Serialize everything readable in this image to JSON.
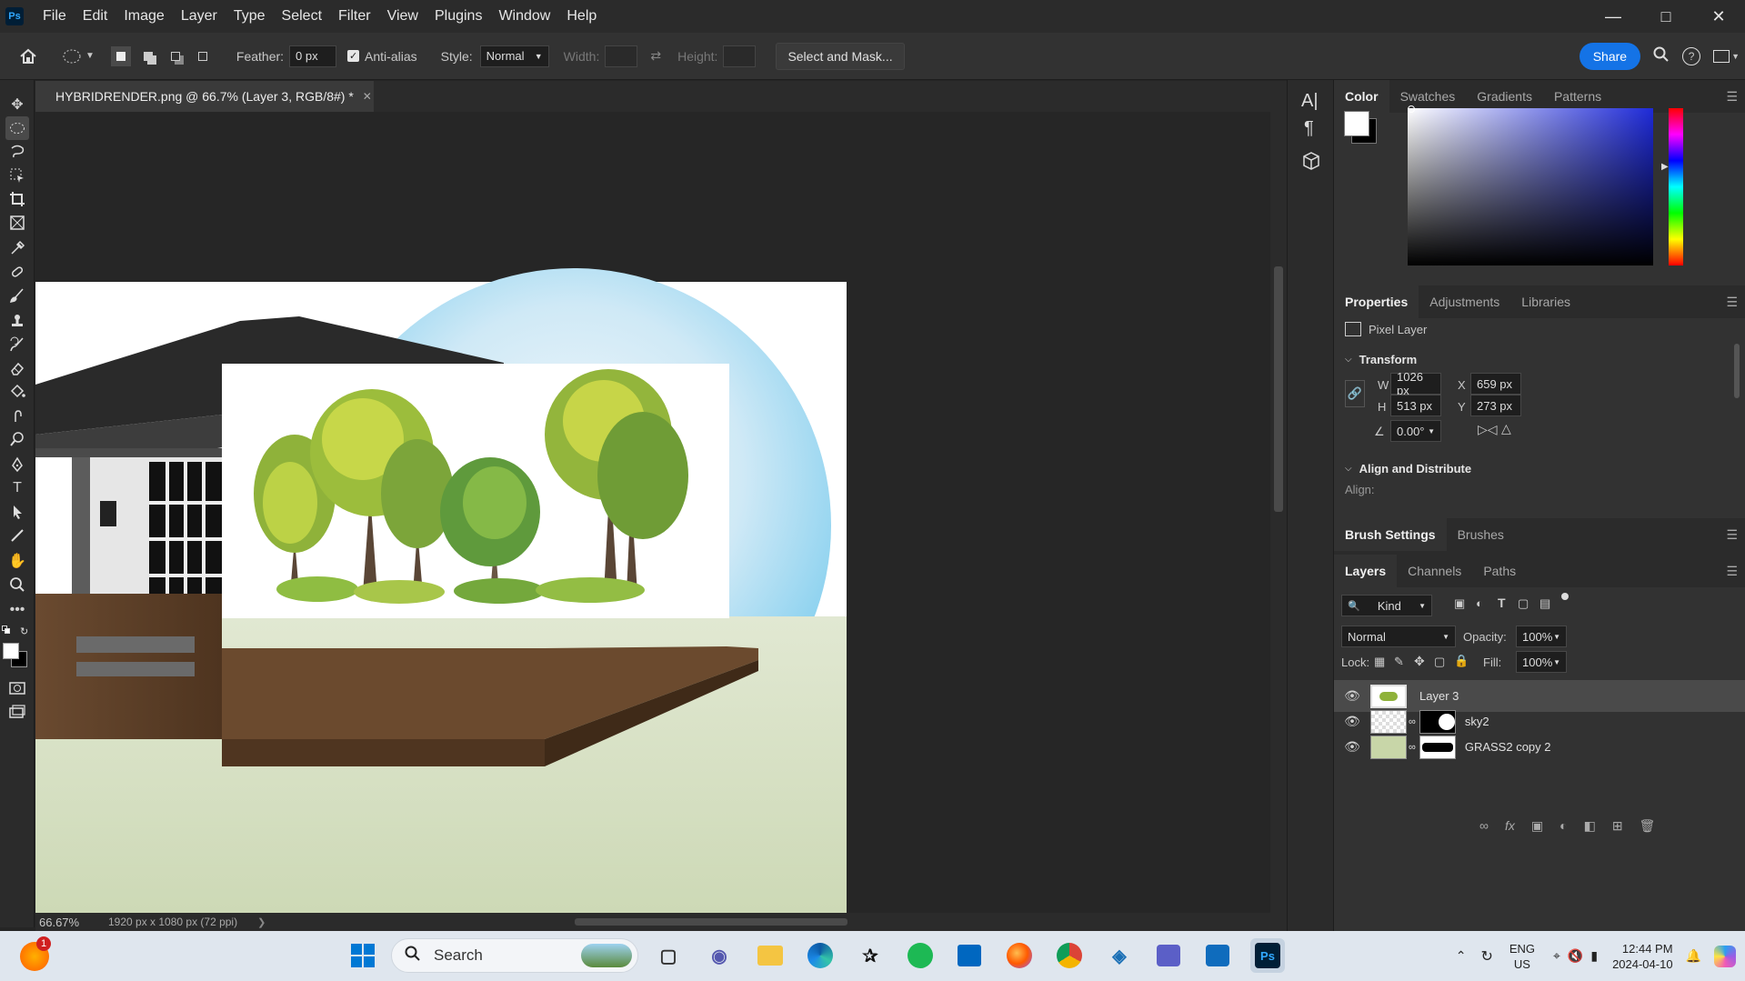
{
  "app": {
    "logo": "Ps",
    "menu": [
      "File",
      "Edit",
      "Image",
      "Layer",
      "Type",
      "Select",
      "Filter",
      "View",
      "Plugins",
      "Window",
      "Help"
    ],
    "window_controls": [
      "minimize-icon",
      "maximize-icon",
      "close-icon"
    ]
  },
  "options_bar": {
    "feather_label": "Feather:",
    "feather_value": "0 px",
    "antialias_label": "Anti-alias",
    "antialias_checked": true,
    "style_label": "Style:",
    "style_value": "Normal",
    "width_label": "Width:",
    "height_label": "Height:",
    "select_mask_label": "Select and Mask...",
    "share_label": "Share"
  },
  "document": {
    "tab_title": "HYBRIDRENDER.png @ 66.7% (Layer 3, RGB/8#) *",
    "zoom": "66.67%",
    "dimensions": "1920 px x 1080 px (72 ppi)"
  },
  "color_panel": {
    "tabs": [
      "Color",
      "Swatches",
      "Gradients",
      "Patterns"
    ],
    "active_tab": "Color",
    "foreground": "#ffffff",
    "background": "#000000",
    "hue_color": "#1e2ad8"
  },
  "properties_panel": {
    "tabs": [
      "Properties",
      "Adjustments",
      "Libraries"
    ],
    "active_tab": "Properties",
    "layer_type": "Pixel Layer",
    "transform_label": "Transform",
    "w_label": "W",
    "w_value": "1026 px",
    "h_label": "H",
    "h_value": "513 px",
    "x_label": "X",
    "x_value": "659 px",
    "y_label": "Y",
    "y_value": "273 px",
    "angle_value": "0.00°",
    "align_label": "Align and Distribute",
    "align_sub": "Align:"
  },
  "brush_panel": {
    "tabs": [
      "Brush Settings",
      "Brushes"
    ],
    "active_tab": "Brush Settings"
  },
  "layers_panel": {
    "tabs": [
      "Layers",
      "Channels",
      "Paths"
    ],
    "active_tab": "Layers",
    "filter_kind": "Kind",
    "blend_mode": "Normal",
    "opacity_label": "Opacity:",
    "opacity_value": "100%",
    "lock_label": "Lock:",
    "fill_label": "Fill:",
    "fill_value": "100%",
    "layers": [
      {
        "name": "Layer 3",
        "selected": true,
        "has_mask": false
      },
      {
        "name": "sky2",
        "selected": false,
        "has_mask": true
      },
      {
        "name": "GRASS2 copy 2",
        "selected": false,
        "has_mask": true
      }
    ]
  },
  "taskbar": {
    "search_placeholder": "Search",
    "notification_badge": "1",
    "language_line1": "ENG",
    "language_line2": "US",
    "time": "12:44 PM",
    "date": "2024-04-10"
  }
}
